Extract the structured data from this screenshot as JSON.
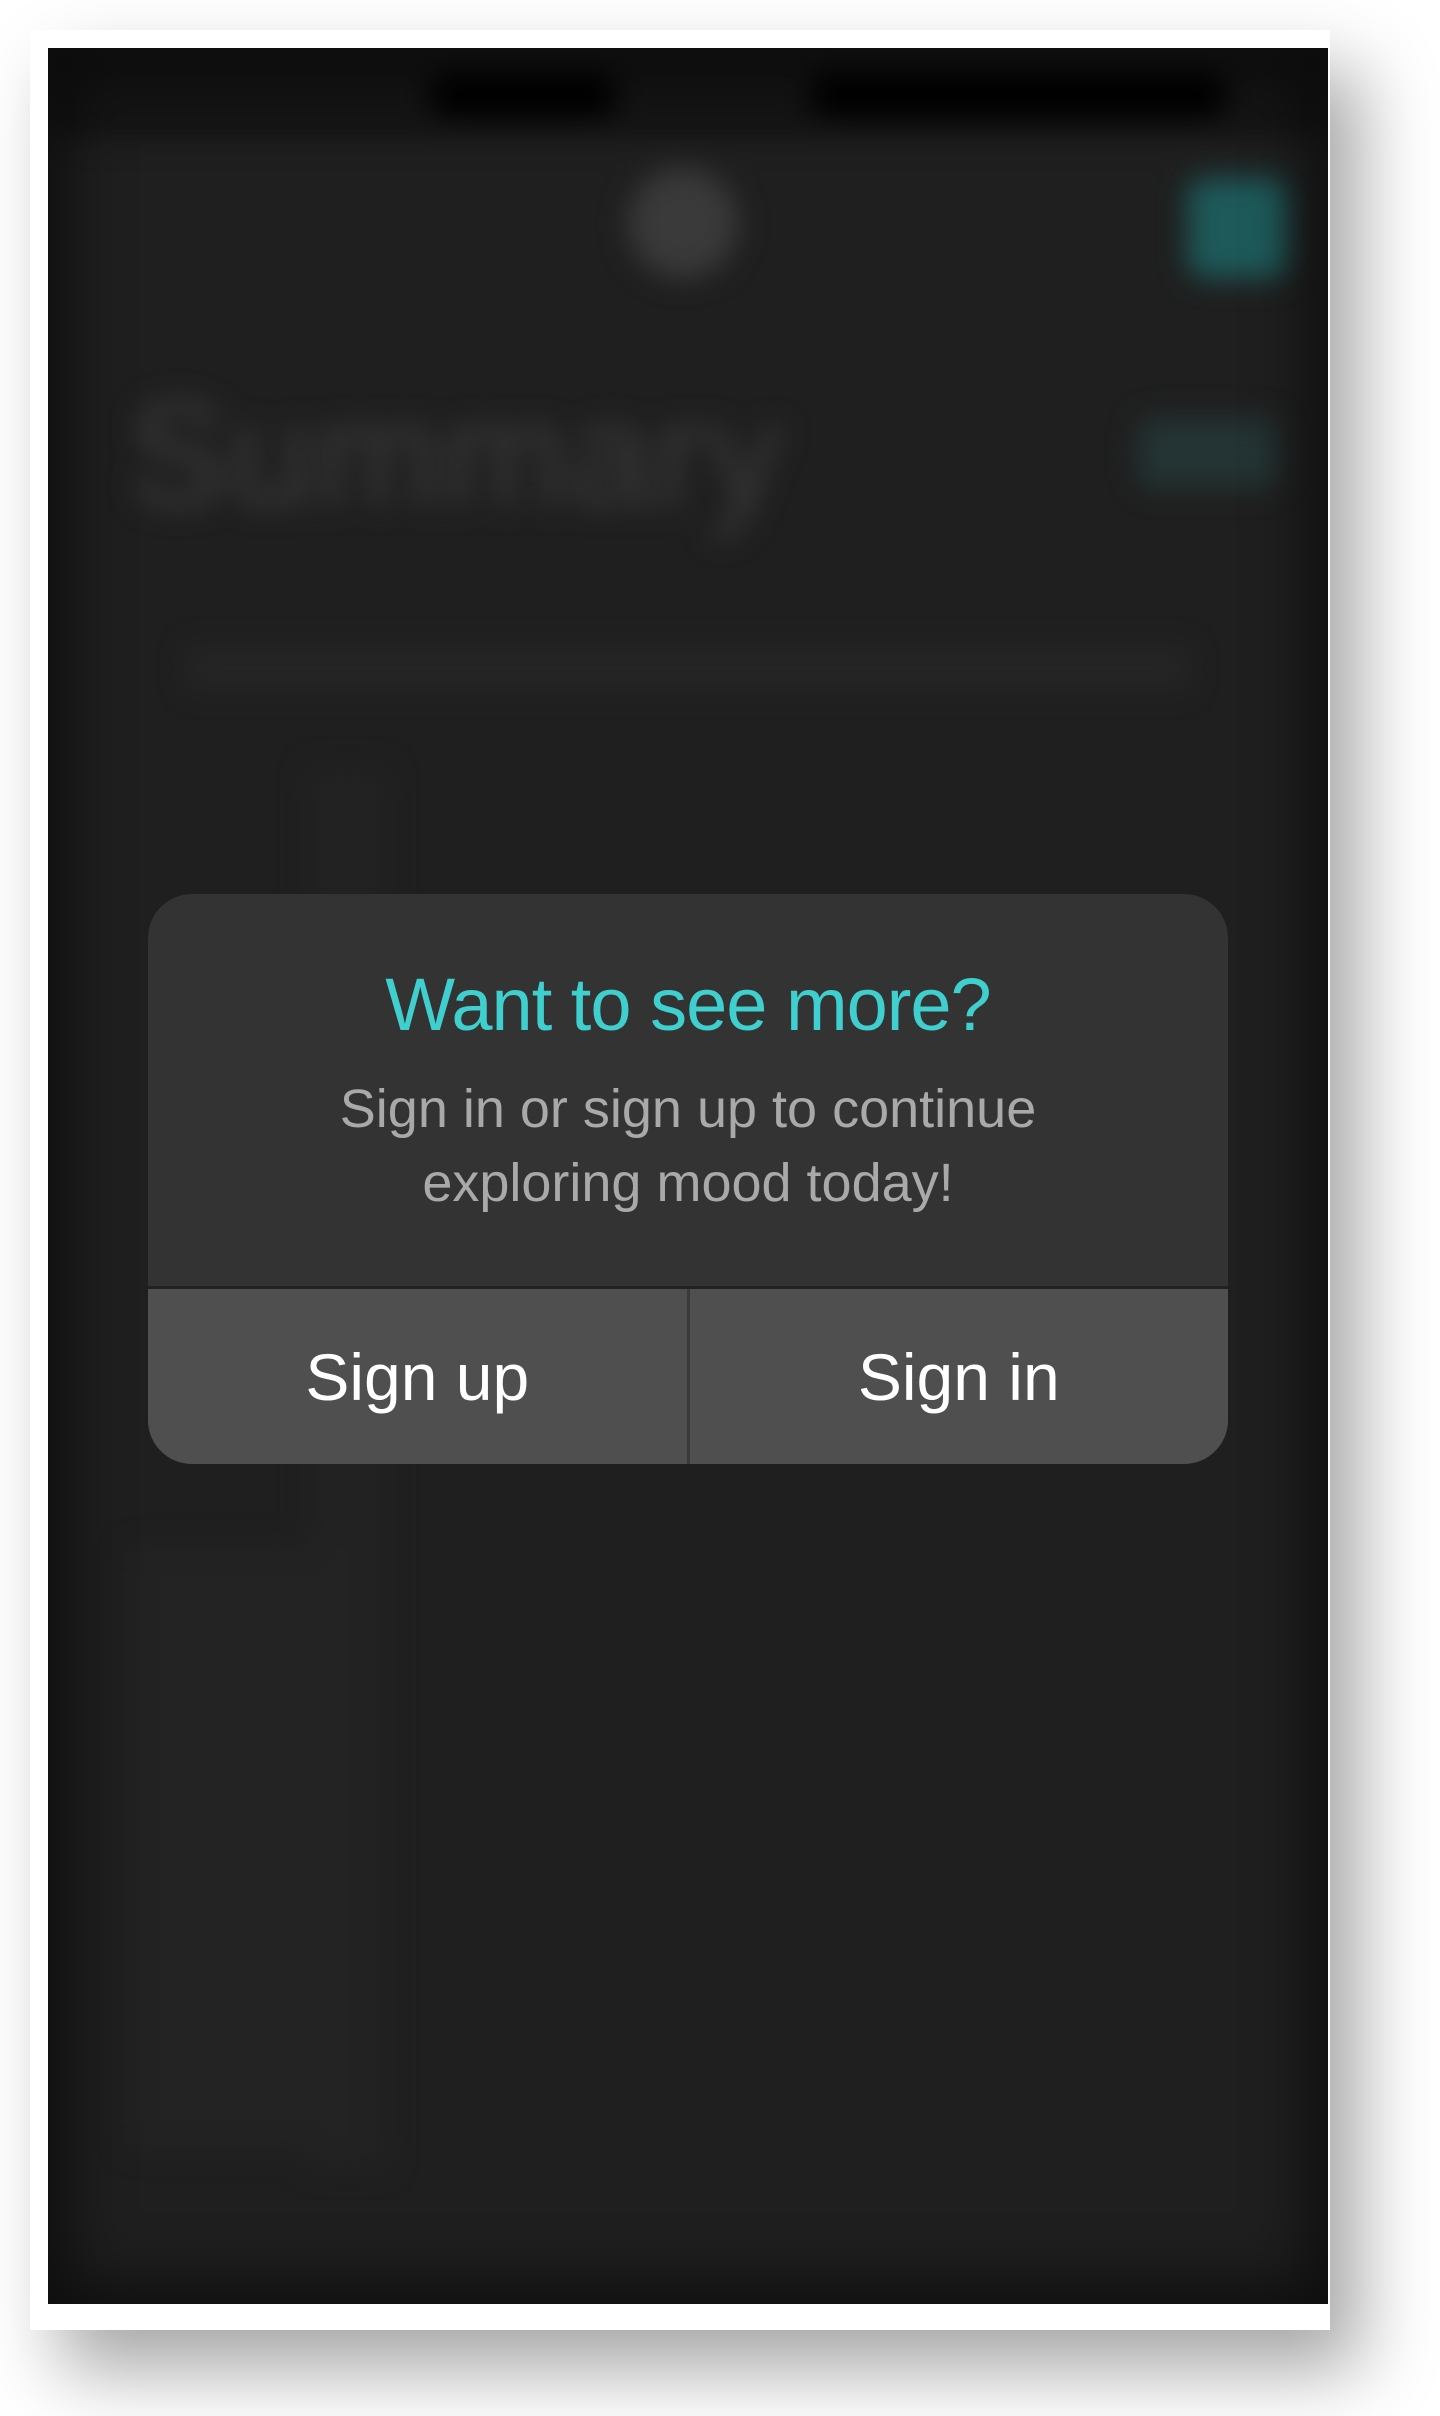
{
  "background": {
    "title": "Summary",
    "accent_color": "#1e5a5a",
    "screen_color": "#1f1f1f"
  },
  "modal": {
    "title": "Want to see more?",
    "message_line1": "Sign in or sign up to continue",
    "message_line2": "exploring mood today!",
    "title_color": "#3fcfce",
    "actions": {
      "sign_up_label": "Sign up",
      "sign_in_label": "Sign in"
    }
  }
}
